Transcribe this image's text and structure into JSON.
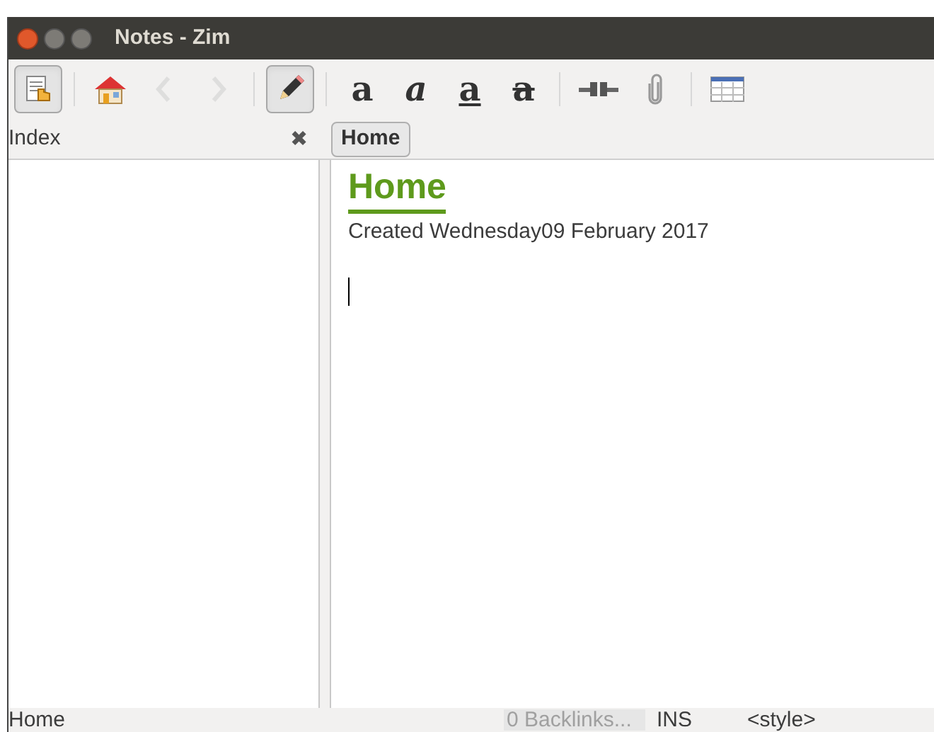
{
  "window": {
    "title": "Notes - Zim"
  },
  "toolbar": [
    {
      "kind": "index",
      "pressed": true,
      "disabled": false
    },
    {
      "kind": "separator"
    },
    {
      "kind": "home",
      "pressed": false,
      "disabled": false
    },
    {
      "kind": "back",
      "pressed": false,
      "disabled": true
    },
    {
      "kind": "forward",
      "pressed": false,
      "disabled": true
    },
    {
      "kind": "separator"
    },
    {
      "kind": "edit",
      "pressed": true,
      "disabled": false
    },
    {
      "kind": "separator"
    },
    {
      "kind": "bold",
      "label": "a",
      "pressed": false,
      "disabled": false
    },
    {
      "kind": "italic",
      "label": "a",
      "pressed": false,
      "disabled": false
    },
    {
      "kind": "underline",
      "label": "a",
      "pressed": false,
      "disabled": false
    },
    {
      "kind": "strike",
      "label": "a",
      "pressed": false,
      "disabled": false
    },
    {
      "kind": "separator"
    },
    {
      "kind": "link",
      "pressed": false,
      "disabled": false
    },
    {
      "kind": "attach",
      "pressed": false,
      "disabled": false
    },
    {
      "kind": "separator"
    },
    {
      "kind": "table",
      "pressed": false,
      "disabled": false
    }
  ],
  "index": {
    "title": "Index",
    "close": "✖"
  },
  "path_bar": [
    {
      "label": "Home",
      "selected": true
    }
  ],
  "page": {
    "heading": "Home",
    "created": "Created Wednesday09 February 2017"
  },
  "status_bar": {
    "page": "Home",
    "backlinks": "0 Backlinks...",
    "mode": "INS",
    "style": "<style>"
  }
}
